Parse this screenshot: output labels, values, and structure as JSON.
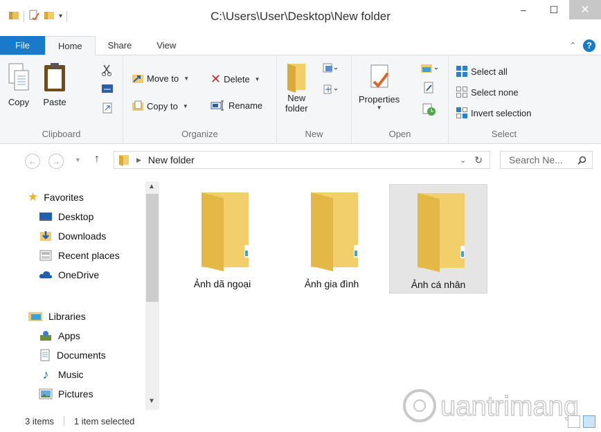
{
  "window": {
    "title": "C:\\Users\\User\\Desktop\\New folder",
    "minimize": "–",
    "maximize": "☐",
    "close": "✕"
  },
  "tabs": [
    {
      "label": "File"
    },
    {
      "label": "Home"
    },
    {
      "label": "Share"
    },
    {
      "label": "View"
    }
  ],
  "ribbon": {
    "clipboard": {
      "label": "Clipboard",
      "copy": "Copy",
      "paste": "Paste"
    },
    "organize": {
      "label": "Organize",
      "move_to": "Move to",
      "copy_to": "Copy to",
      "delete": "Delete",
      "rename": "Rename"
    },
    "new": {
      "label": "New",
      "new_folder_1": "New",
      "new_folder_2": "folder"
    },
    "open": {
      "label": "Open",
      "properties": "Properties"
    },
    "select": {
      "label": "Select",
      "select_all": "Select all",
      "select_none": "Select none",
      "invert": "Invert selection"
    }
  },
  "address": {
    "path": "New folder",
    "search_placeholder": "Search Ne..."
  },
  "nav": {
    "favorites": "Favorites",
    "desktop": "Desktop",
    "downloads": "Downloads",
    "recent": "Recent places",
    "onedrive": "OneDrive",
    "libraries": "Libraries",
    "apps": "Apps",
    "documents": "Documents",
    "music": "Music",
    "pictures": "Pictures"
  },
  "items": [
    {
      "name": "Ảnh dã ngoại",
      "selected": false
    },
    {
      "name": "Ảnh gia đình",
      "selected": false
    },
    {
      "name": "Ảnh cá nhân",
      "selected": true
    }
  ],
  "status": {
    "count": "3 items",
    "selected": "1 item selected"
  },
  "watermark": "uantrimang",
  "colors": {
    "accent": "#1979ca",
    "folder": "#f2cf6b",
    "folder_dark": "#e1b84a"
  }
}
